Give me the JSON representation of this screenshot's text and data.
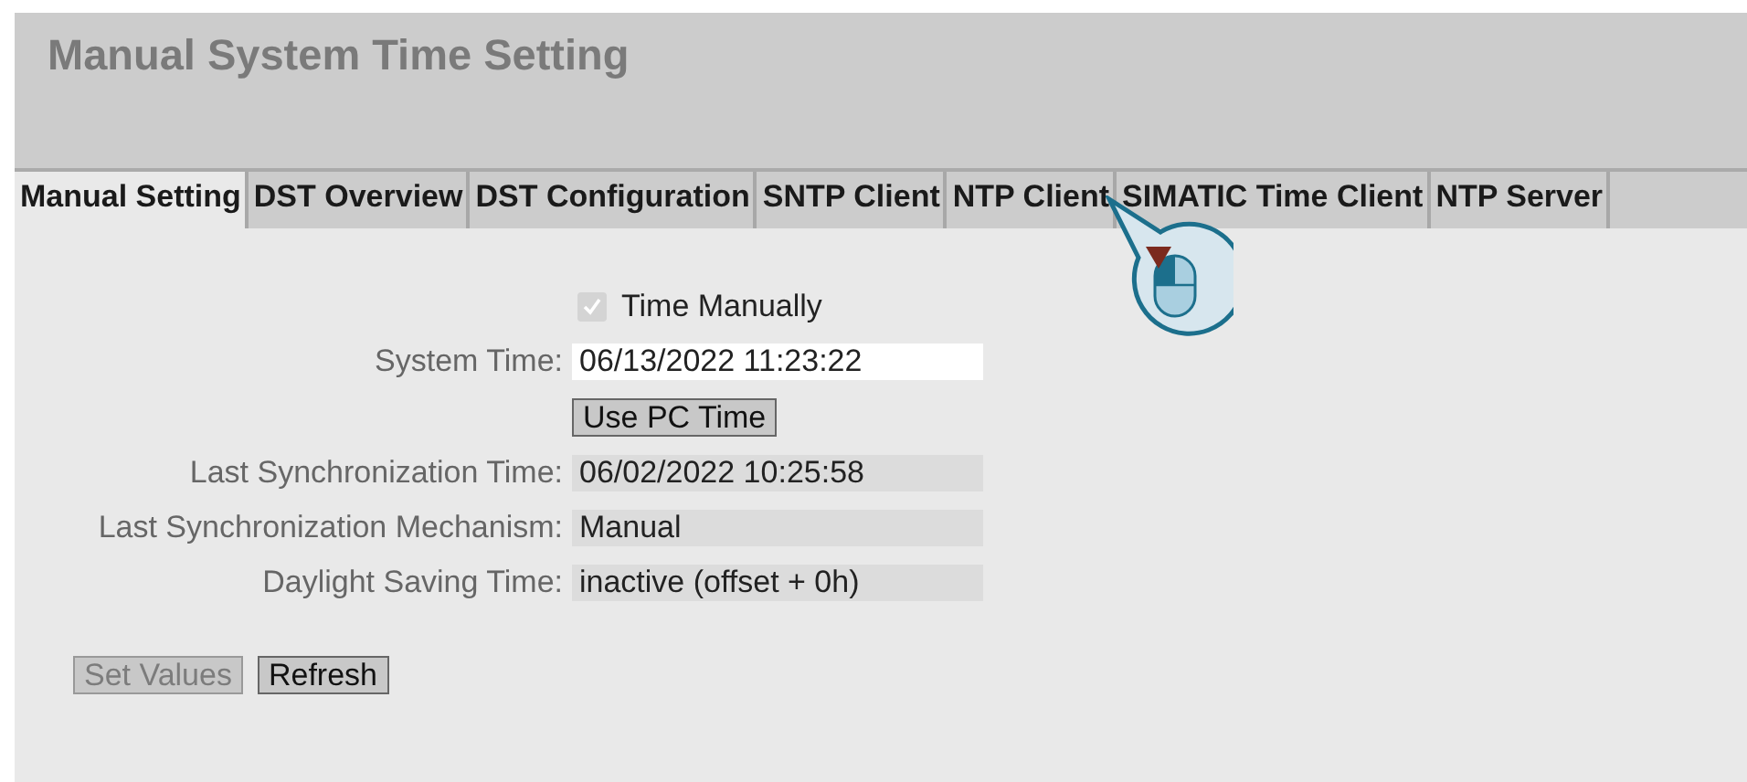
{
  "page": {
    "title": "Manual System Time Setting"
  },
  "tabs": [
    {
      "label": "Manual Setting",
      "selected": true
    },
    {
      "label": "DST Overview",
      "selected": false
    },
    {
      "label": "DST Configuration",
      "selected": false
    },
    {
      "label": "SNTP Client",
      "selected": false
    },
    {
      "label": "NTP Client",
      "selected": false
    },
    {
      "label": "SIMATIC Time Client",
      "selected": false
    },
    {
      "label": "NTP Server",
      "selected": false
    }
  ],
  "form": {
    "checkbox": {
      "label": "Time Manually",
      "checked": true,
      "disabled": true
    },
    "rows": [
      {
        "kind": "input",
        "label": "System Time:",
        "value": "06/13/2022 11:23:22"
      },
      {
        "kind": "button",
        "label": "Use PC Time"
      },
      {
        "kind": "readonly",
        "label": "Last Synchronization Time:",
        "value": "06/02/2022 10:25:58"
      },
      {
        "kind": "readonly",
        "label": "Last Synchronization Mechanism:",
        "value": "Manual"
      },
      {
        "kind": "readonly",
        "label": "Daylight Saving Time:",
        "value": "inactive (offset + 0h)"
      }
    ]
  },
  "buttons": [
    {
      "label": "Set Values",
      "disabled": true
    },
    {
      "label": "Refresh",
      "disabled": false
    }
  ]
}
